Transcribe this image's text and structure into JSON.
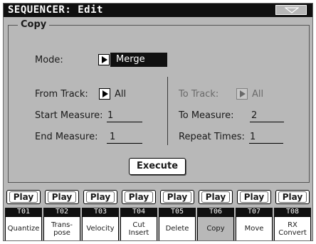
{
  "header": {
    "title": "SEQUENCER: Edit",
    "menu_icon": "triangle-down-icon"
  },
  "panel": {
    "title": "Copy"
  },
  "mode": {
    "label": "Mode:",
    "value": "Merge"
  },
  "from_track": {
    "label": "From Track:",
    "value": "All"
  },
  "to_track": {
    "label": "To Track:",
    "value": "All"
  },
  "start_measure": {
    "label": "Start Measure:",
    "value": "1"
  },
  "to_measure": {
    "label": "To Measure:",
    "value": "2"
  },
  "end_measure": {
    "label": "End Measure:",
    "value": "1"
  },
  "repeat_times": {
    "label": "Repeat Times:",
    "value": "1"
  },
  "execute_label": "Execute",
  "tracks": [
    {
      "play": "Play",
      "num": "T01"
    },
    {
      "play": "Play",
      "num": "T02"
    },
    {
      "play": "Play",
      "num": "T03"
    },
    {
      "play": "Play",
      "num": "T04"
    },
    {
      "play": "Play",
      "num": "T05"
    },
    {
      "play": "Play",
      "num": "T06"
    },
    {
      "play": "Play",
      "num": "T07"
    },
    {
      "play": "Play",
      "num": "T08"
    }
  ],
  "tabs": [
    {
      "line1": "Quantize",
      "line2": ""
    },
    {
      "line1": "Trans-",
      "line2": "pose"
    },
    {
      "line1": "Velocity",
      "line2": ""
    },
    {
      "line1": "Cut",
      "line2": "Insert"
    },
    {
      "line1": "Delete",
      "line2": ""
    },
    {
      "line1": "Copy",
      "line2": ""
    },
    {
      "line1": "Move",
      "line2": ""
    },
    {
      "line1": "RX",
      "line2": "Convert"
    }
  ],
  "active_tab": "Copy",
  "colors": {
    "background": "#b8b8b8",
    "titlebar": "#101010",
    "highlight": "#101010"
  }
}
